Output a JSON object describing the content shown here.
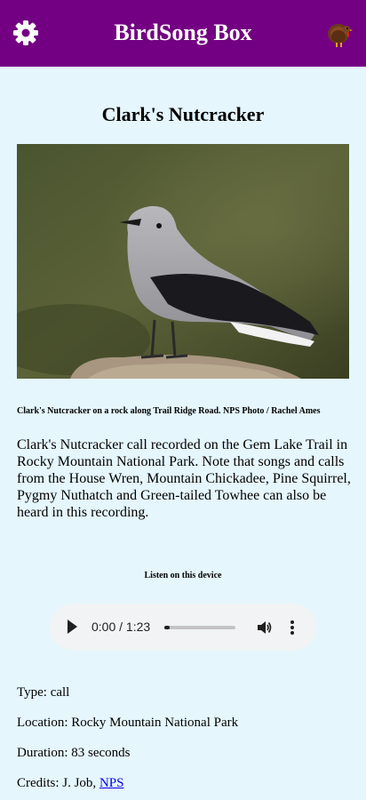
{
  "header": {
    "title": "BirdSong Box",
    "settings_icon": "gear-icon",
    "mascot_icon": "turkey-icon",
    "background": "#730082"
  },
  "bird": {
    "name": "Clark's Nutcracker",
    "photo_caption": "Clark's Nutcracker on a rock along Trail Ridge Road. NPS Photo / Rachel Ames",
    "description": "Clark's Nutcracker call recorded on the Gem Lake Trail in Rocky Mountain National Park. Note that songs and calls from the House Wren, Mountain Chickadee, Pine Squirrel, Pygmy Nuthatch and Green-tailed Towhee can also be heard in this recording."
  },
  "audio": {
    "listen_label": "Listen on this device",
    "time_display": "0:00 / 1:23",
    "progress": 0.0
  },
  "details": {
    "type": "Type: call",
    "location": "Location: Rocky Mountain National Park",
    "duration": "Duration: 83 seconds",
    "credits_prefix": "Credits: J. Job, ",
    "credits_link": "NPS"
  }
}
